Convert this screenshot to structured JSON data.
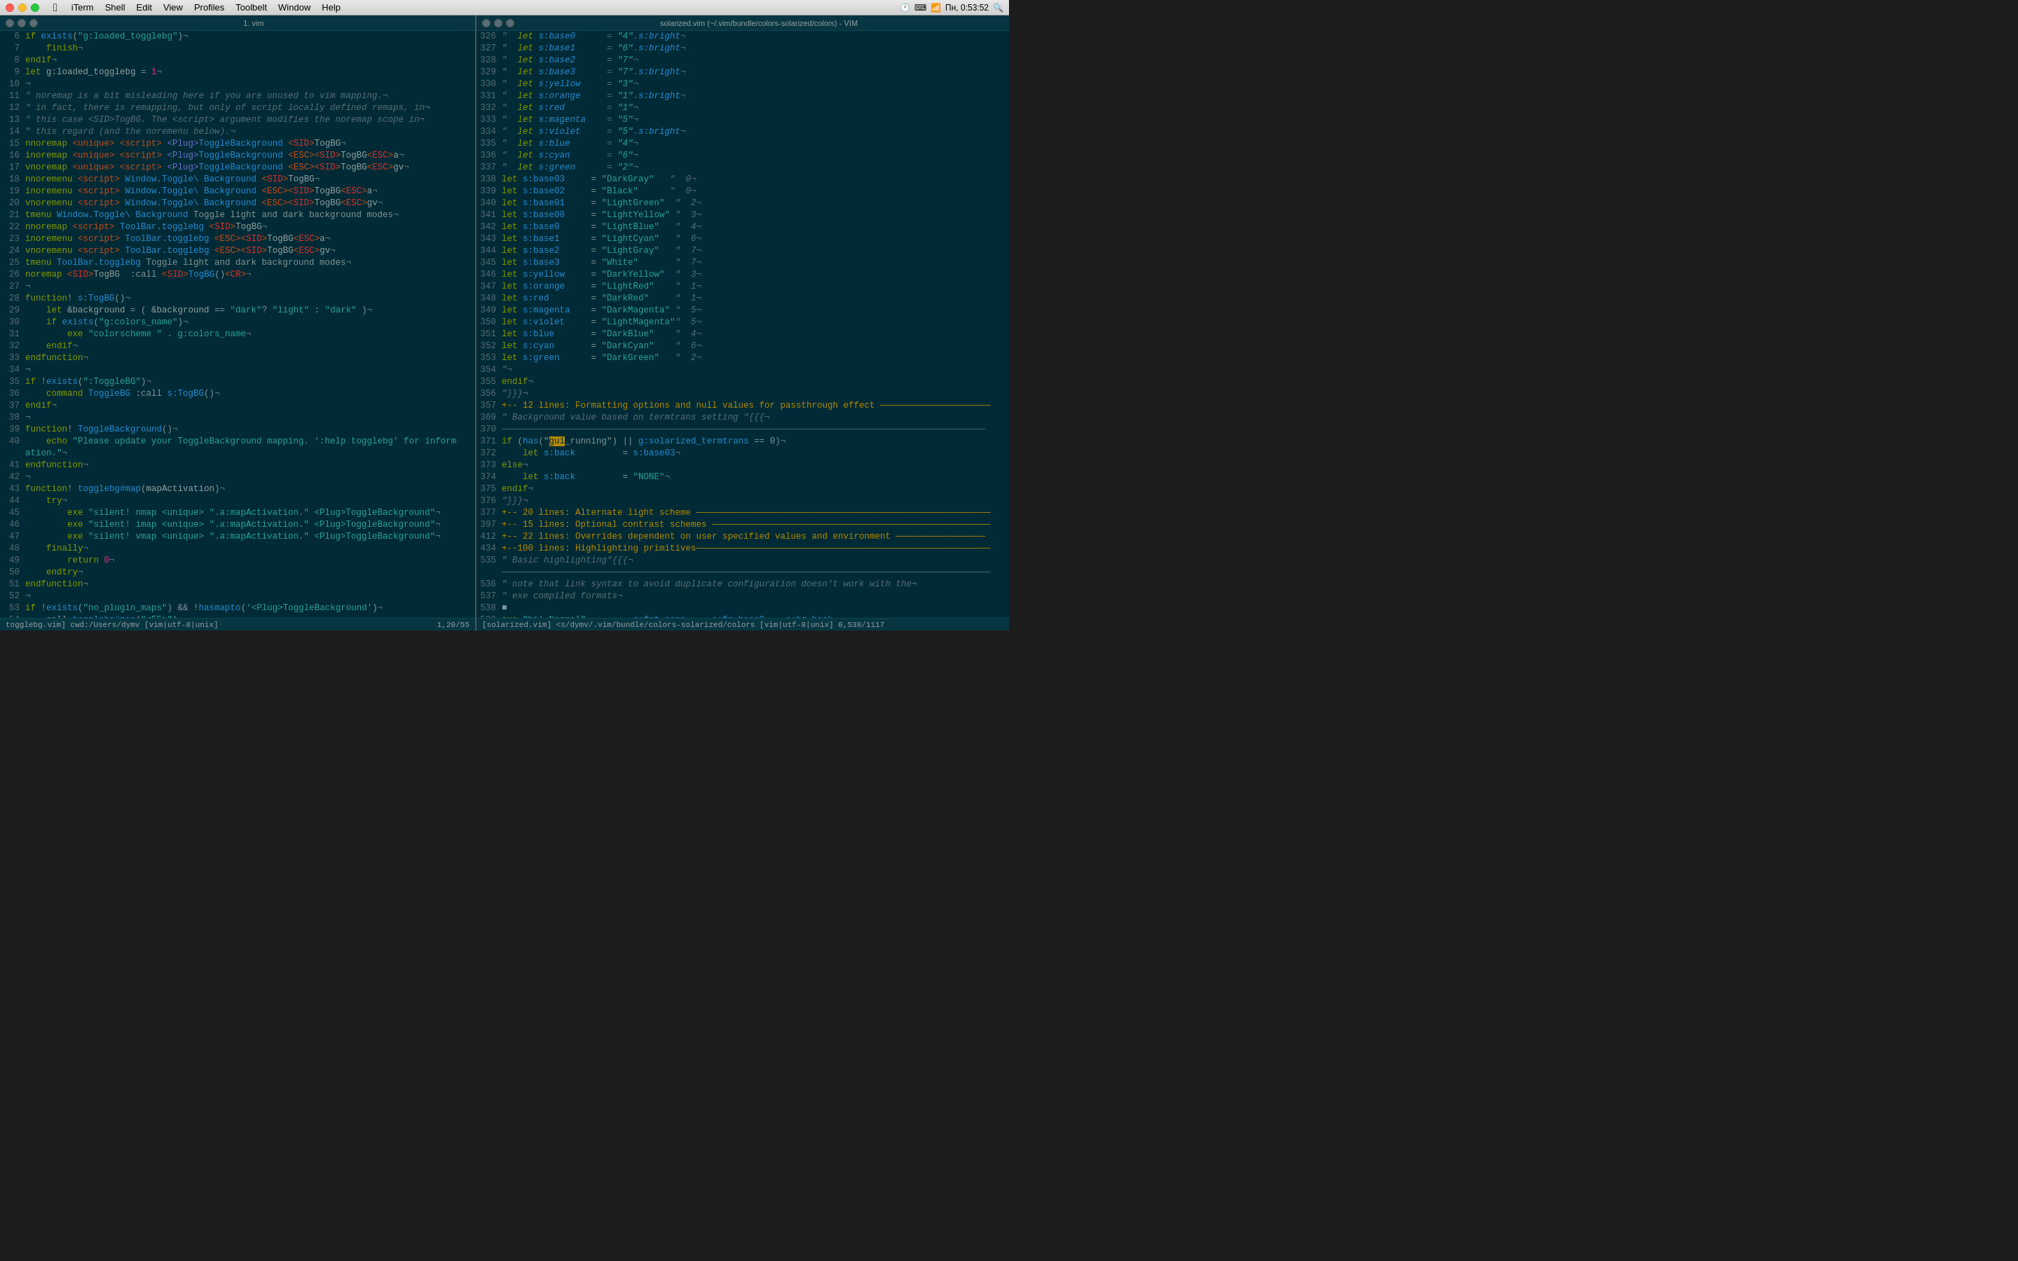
{
  "titlebar": {
    "menu_items": [
      "",
      "iTerm",
      "Shell",
      "Edit",
      "View",
      "Profiles",
      "Toolbelt",
      "Window",
      "Help"
    ],
    "window_title": "1. vim",
    "right_title": "solarized.vim (~/.vim/bundle/colors-solarized/colors) - VIM",
    "time": "Пн, 0:53:52"
  },
  "left_pane": {
    "tab_title": "1. vim",
    "status": "togglebg.vim] cwd:/Users/dymv [vim|utf-8|unix]",
    "status_right": "1,20/55"
  },
  "right_pane": {
    "tab_title": "solarized.vim (~/.vim/bundle/colors-solarized/colors) - VIM",
    "status": "[solarized.vim] <s/dymv/.vim/bundle/colors-solarized/colors [vim|utf-8|unix] 0,538/1117"
  }
}
